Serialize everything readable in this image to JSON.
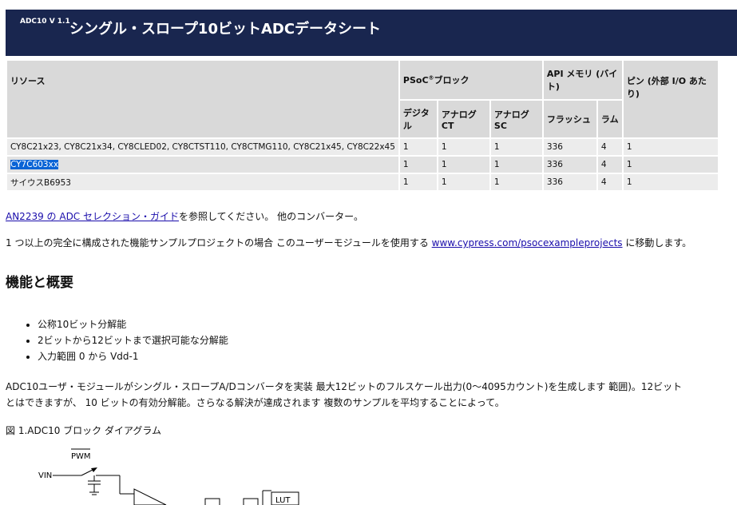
{
  "header": {
    "version": "ADC10 V 1.1",
    "title": "シングル・スロープ10ビットADCデータシート"
  },
  "table": {
    "h_resource": "リソース",
    "h_psoc_prefix": "PSoC",
    "h_psoc_reg": "®",
    "h_psoc_suffix": "ブロック",
    "h_api": "API メモリ (バイト)",
    "h_pins": "ピン (外部 I/O あたり)",
    "h_digital": "デジタル",
    "h_analog_ct": "アナログCT",
    "h_analog_sc": "アナログSC",
    "h_flash": "フラッシュ",
    "h_ram": "ラム",
    "rows": [
      {
        "resource": "CY8C21x23, CY8C21x34, CY8CLED02, CY8CTST110, CY8CTMG110, CY8C21x45, CY8C22x45",
        "digital": "1",
        "ct": "1",
        "sc": "1",
        "flash": "336",
        "ram": "4",
        "pins": "1"
      },
      {
        "resource": "CY7C603xx",
        "digital": "1",
        "ct": "1",
        "sc": "1",
        "flash": "336",
        "ram": "4",
        "pins": "1"
      },
      {
        "resource": "サイウスB6953",
        "digital": "1",
        "ct": "1",
        "sc": "1",
        "flash": "336",
        "ram": "4",
        "pins": "1"
      }
    ]
  },
  "body": {
    "p1_link": "AN2239 の ADC セレクション・ガイド",
    "p1_rest": "を参照してください。 他のコンバーター。",
    "p2_start": "1 つ以上の完全に構成された機能サンプルプロジェクトの場合 このユーザーモジュールを使用する ",
    "p2_link": "www.cypress.com/psocexampleprojects",
    "p2_end": " に移動します。",
    "section_title": "機能と概要",
    "features": [
      "公称10ビット分解能",
      "2ビットから12ビットまで選択可能な分解能",
      "入力範囲 0 から Vdd-1"
    ],
    "para_line1": "ADC10ユーザ・モジュールがシングル・スロープA/Dコンバータを実装 最大12ビットのフルスケール出力(0～4095カウント)を生成します 範囲)。12ビット",
    "para_line2": "とはできますが、 10 ビットの有効分解能。さらなる解決が達成されます 複数のサンプルを平均することによって。",
    "figure_caption": "図 1.ADC10 ブロック ダイアグラム"
  },
  "diagram": {
    "pwm_label": "PWM",
    "vin_label": "VIN",
    "lut_label": "LUT"
  }
}
